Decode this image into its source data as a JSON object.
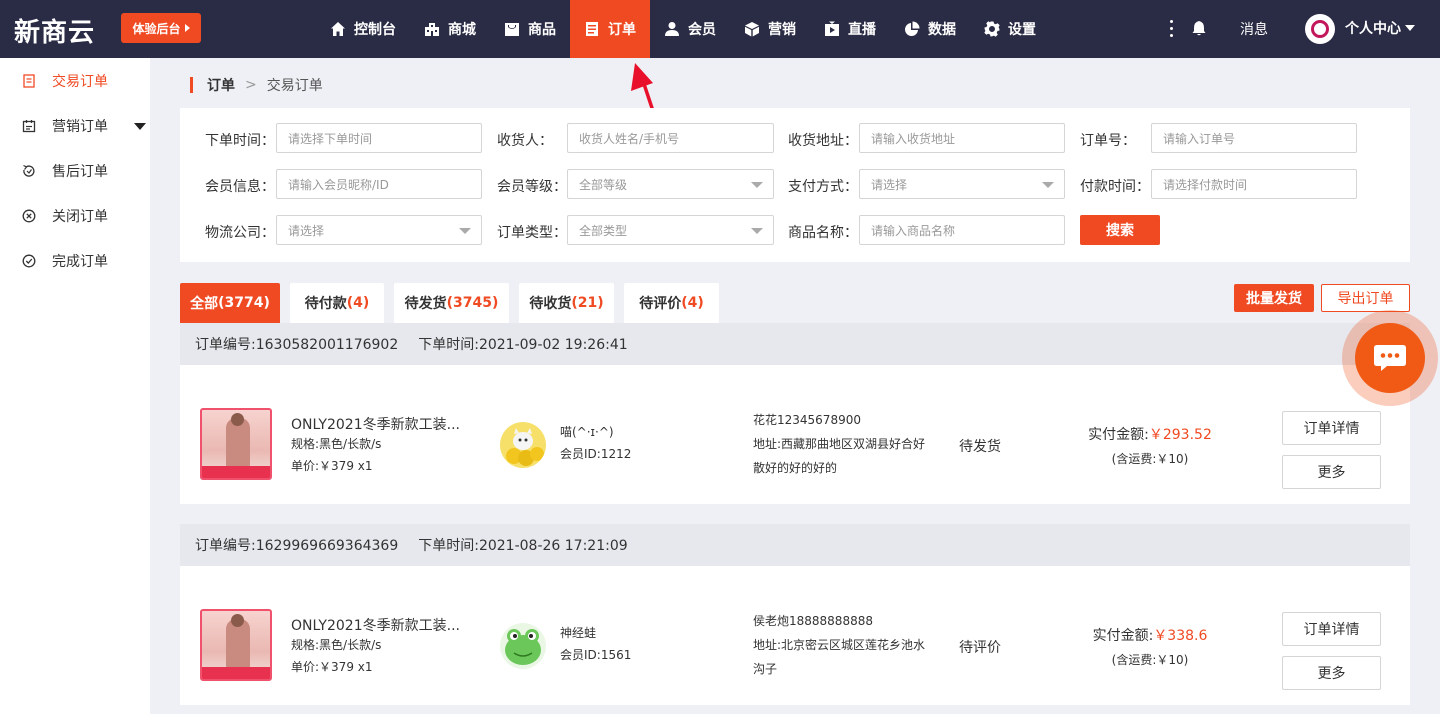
{
  "topbar": {
    "logo": "新商云",
    "trial_button": "体验后台",
    "nav": [
      {
        "label": "控制台",
        "icon": "home-icon"
      },
      {
        "label": "商城",
        "icon": "store-icon"
      },
      {
        "label": "商品",
        "icon": "product-icon"
      },
      {
        "label": "订单",
        "icon": "order-icon",
        "active": true
      },
      {
        "label": "会员",
        "icon": "member-icon"
      },
      {
        "label": "营销",
        "icon": "cube-icon"
      },
      {
        "label": "直播",
        "icon": "live-icon"
      },
      {
        "label": "数据",
        "icon": "pie-icon"
      },
      {
        "label": "设置",
        "icon": "gear-icon"
      }
    ],
    "messages_label": "消息",
    "personal_center": "个人中心"
  },
  "sidebar": {
    "items": [
      {
        "label": "交易订单",
        "icon": "document-icon",
        "active": true
      },
      {
        "label": "营销订单",
        "icon": "calendar-icon"
      },
      {
        "label": "售后订单",
        "icon": "return-icon"
      },
      {
        "label": "关闭订单",
        "icon": "close-circle-icon"
      },
      {
        "label": "完成订单",
        "icon": "check-circle-icon"
      }
    ]
  },
  "breadcrumb": {
    "current": "订单",
    "separator": ">",
    "sub": "交易订单"
  },
  "filters": {
    "order_time": {
      "label": "下单时间：",
      "placeholder": "请选择下单时间"
    },
    "receiver": {
      "label": "收货人：",
      "placeholder": "收货人姓名/手机号"
    },
    "address": {
      "label": "收货地址：",
      "placeholder": "请输入收货地址"
    },
    "order_no": {
      "label": "订单号：",
      "placeholder": "请输入订单号"
    },
    "member_info": {
      "label": "会员信息：",
      "placeholder": "请输入会员昵称/ID"
    },
    "member_level": {
      "label": "会员等级：",
      "value": "全部等级"
    },
    "pay_method": {
      "label": "支付方式：",
      "value": "请选择"
    },
    "pay_time": {
      "label": "付款时间：",
      "placeholder": "请选择付款时间"
    },
    "logistics": {
      "label": "物流公司：",
      "value": "请选择"
    },
    "order_type": {
      "label": "订单类型：",
      "value": "全部类型"
    },
    "product_name": {
      "label": "商品名称：",
      "placeholder": "请输入商品名称"
    },
    "search_button": "搜索"
  },
  "tabs": [
    {
      "label": "全部",
      "count": "(3774)",
      "active": true
    },
    {
      "label": "待付款",
      "count": "(4)"
    },
    {
      "label": "待发货",
      "count": "(3745)"
    },
    {
      "label": "待收货",
      "count": "(21)"
    },
    {
      "label": "待评价",
      "count": "(4)"
    }
  ],
  "actions": {
    "batch_ship": "批量发货",
    "export": "导出订单"
  },
  "orders": [
    {
      "order_no": "订单编号:1630582001176902",
      "order_time": "下单时间:2021-09-02 19:26:41",
      "product_title": "ONLY2021冬季新款工装...",
      "spec": "规格:黑色/长款/s",
      "price": "单价:￥379   x1",
      "member_name": "喵(^·ɪ·^)",
      "member_id": "会员ID:1212",
      "receiver": "花花12345678900",
      "address": "地址:西藏那曲地区双湖县好合好散好的好的好的",
      "status": "待发货",
      "paid_label": "实付金额:",
      "paid_amount": "￥293.52",
      "shipping": "(含运费:￥10)",
      "detail_button": "订单详情",
      "more_button": "更多"
    },
    {
      "order_no": "订单编号:1629969669364369",
      "order_time": "下单时间:2021-08-26 17:21:09",
      "product_title": "ONLY2021冬季新款工装...",
      "spec": "规格:黑色/长款/s",
      "price": "单价:￥379   x1",
      "member_name": "神经蛙",
      "member_id": "会员ID:1561",
      "receiver": "侯老炮18888888888",
      "address": "地址:北京密云区城区莲花乡池水沟子",
      "status": "待评价",
      "paid_label": "实付金额:",
      "paid_amount": "￥338.6",
      "shipping": "(含运费:￥10)",
      "detail_button": "订单详情",
      "more_button": "更多"
    }
  ],
  "colors": {
    "accent": "#f04a23",
    "topbar": "#2a2b45",
    "page_bg": "#eef0f5"
  }
}
